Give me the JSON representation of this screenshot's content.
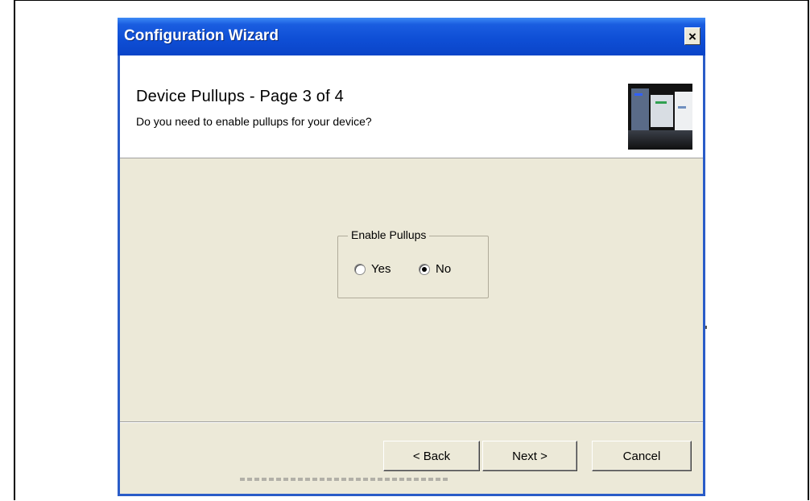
{
  "window": {
    "title": "Configuration Wizard",
    "close_label": "×"
  },
  "header": {
    "title": "Device Pullups  -  Page 3 of 4",
    "subtitle": "Do you need to enable pullups for your device?"
  },
  "group": {
    "legend": "Enable Pullups",
    "options": [
      {
        "label": "Yes",
        "selected": false
      },
      {
        "label": "No",
        "selected": true
      }
    ]
  },
  "buttons": {
    "back": "< Back",
    "next": "Next >",
    "cancel": "Cancel"
  },
  "colors": {
    "titlebar": "#0f4fd6",
    "dialog_bg": "#ece9d8",
    "header_bg": "#ffffff"
  }
}
